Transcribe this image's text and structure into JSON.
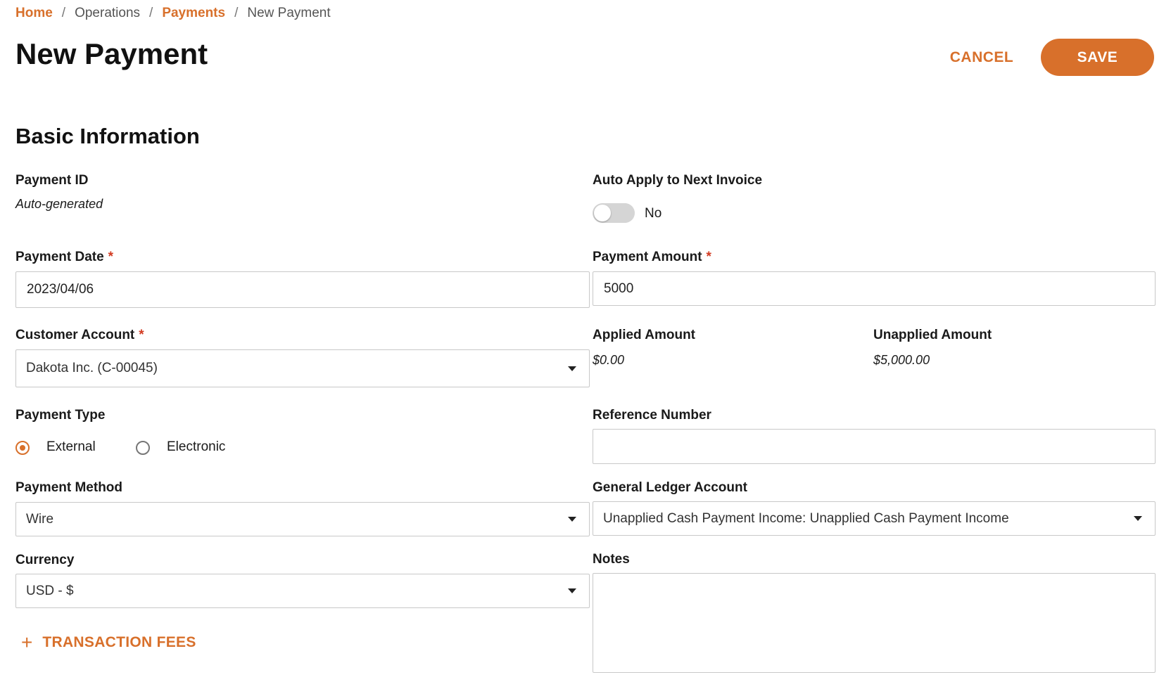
{
  "breadcrumb": {
    "items": [
      {
        "label": "Home",
        "link": true
      },
      {
        "label": "Operations",
        "link": false
      },
      {
        "label": "Payments",
        "link": true
      },
      {
        "label": "New Payment",
        "link": false
      }
    ],
    "separator": "/"
  },
  "header": {
    "title": "New Payment",
    "cancel_label": "CANCEL",
    "save_label": "SAVE"
  },
  "section": {
    "title": "Basic Information"
  },
  "form": {
    "payment_id": {
      "label": "Payment ID",
      "value": "Auto-generated"
    },
    "auto_apply": {
      "label": "Auto Apply to Next Invoice",
      "state_label": "No",
      "enabled": false
    },
    "payment_date": {
      "label": "Payment Date",
      "required": "*",
      "value": "2023/04/06"
    },
    "payment_amount": {
      "label": "Payment Amount",
      "required": "*",
      "value": "5000"
    },
    "customer_account": {
      "label": "Customer Account",
      "required": "*",
      "value": "Dakota Inc. (C-00045)"
    },
    "applied_amount": {
      "label": "Applied Amount",
      "value": "$0.00"
    },
    "unapplied_amount": {
      "label": "Unapplied Amount",
      "value": "$5,000.00"
    },
    "payment_type": {
      "label": "Payment Type",
      "options": [
        {
          "label": "External",
          "selected": true
        },
        {
          "label": "Electronic",
          "selected": false
        }
      ]
    },
    "reference_number": {
      "label": "Reference Number",
      "value": ""
    },
    "payment_method": {
      "label": "Payment Method",
      "value": "Wire"
    },
    "gl_account": {
      "label": "General Ledger Account",
      "value": "Unapplied Cash Payment Income: Unapplied Cash Payment Income"
    },
    "currency": {
      "label": "Currency",
      "value": "USD - $"
    },
    "notes": {
      "label": "Notes",
      "value": ""
    },
    "transaction_fees": {
      "label": "TRANSACTION FEES",
      "icon": "plus-icon"
    }
  },
  "colors": {
    "accent": "#d8702b",
    "required": "#d23b22",
    "border": "#c8c8c8"
  }
}
